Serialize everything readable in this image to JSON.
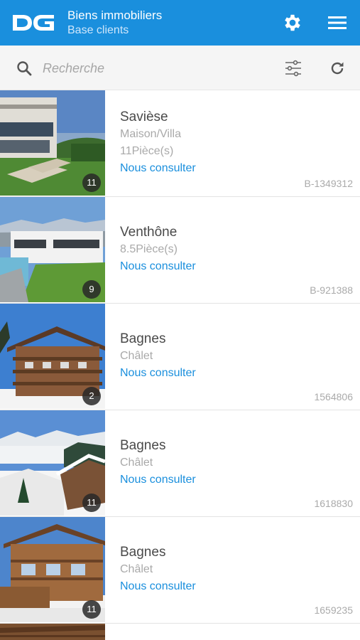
{
  "header": {
    "logo_text": "DG",
    "title": "Biens immobiliers",
    "subtitle": "Base clients",
    "settings_icon": "gear-icon",
    "menu_icon": "hamburger-menu-icon"
  },
  "search": {
    "placeholder": "Recherche",
    "search_icon": "search-icon",
    "filter_icon": "sliders-icon",
    "refresh_icon": "refresh-icon"
  },
  "listings": [
    {
      "city": "Savièse",
      "type": "Maison/Villa",
      "rooms": "11Pièce(s)",
      "price": "Nous consulter",
      "reference": "B-1349312",
      "photo_count": "11"
    },
    {
      "city": "Venthône",
      "rooms": "8.5Pièce(s)",
      "price": "Nous consulter",
      "reference": "B-921388",
      "photo_count": "9"
    },
    {
      "city": "Bagnes",
      "type": "Châlet",
      "price": "Nous consulter",
      "reference": "1564806",
      "photo_count": "2"
    },
    {
      "city": "Bagnes",
      "type": "Châlet",
      "price": "Nous consulter",
      "reference": "1618830",
      "photo_count": "11"
    },
    {
      "city": "Bagnes",
      "type": "Châlet",
      "price": "Nous consulter",
      "reference": "1659235",
      "photo_count": "11"
    }
  ],
  "colors": {
    "primary": "#1a8fdd",
    "price_link": "#1a8fdd",
    "text_secondary": "#a9a9a9"
  }
}
